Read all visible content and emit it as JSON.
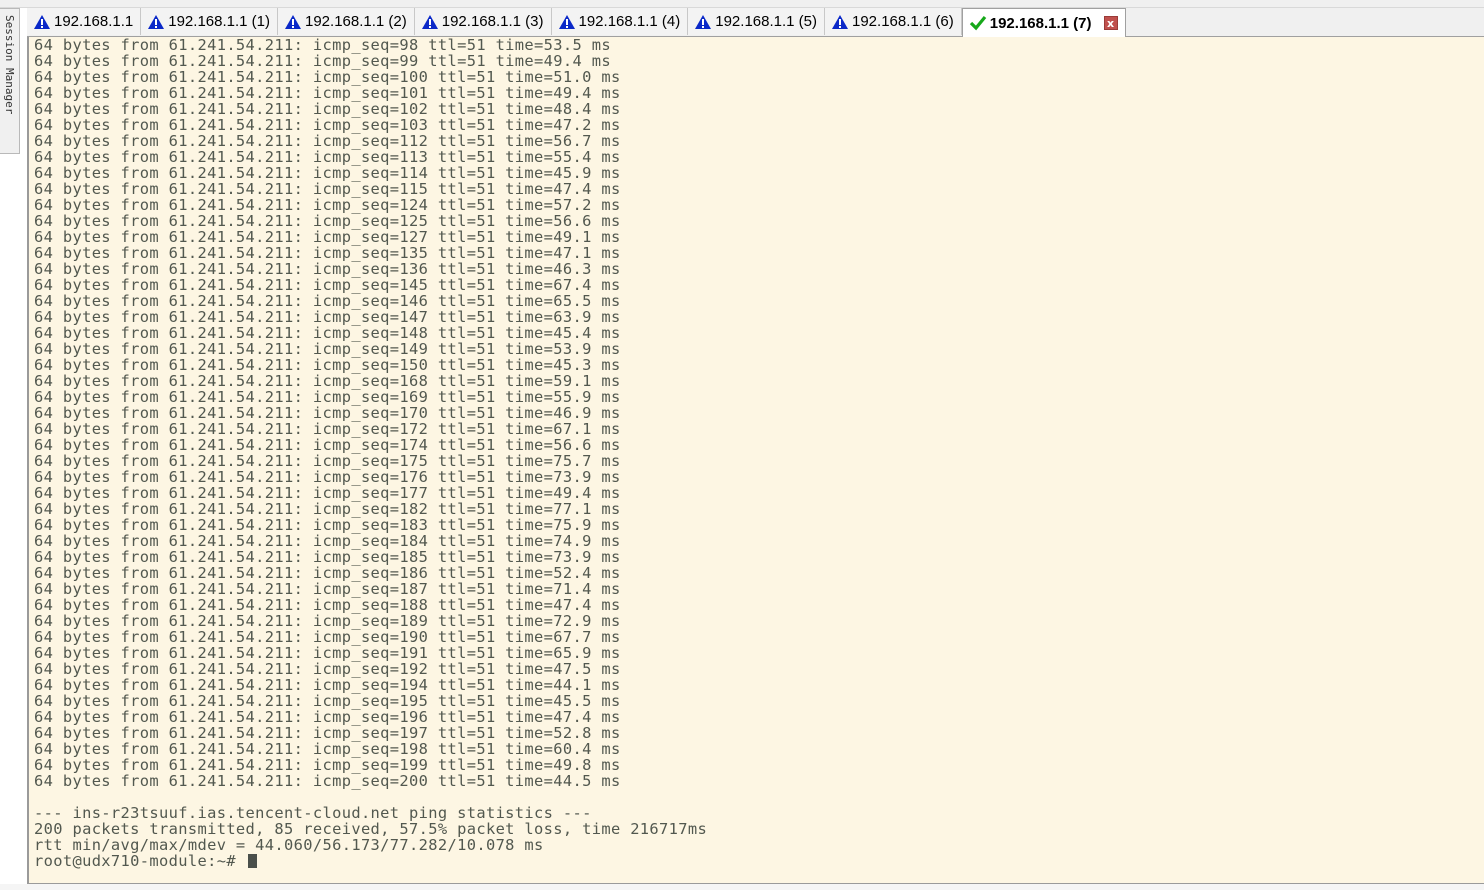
{
  "session_manager": {
    "label": "Session Manager"
  },
  "tabs": [
    {
      "label": "192.168.1.1",
      "status": "warning",
      "icon": "warning-triangle-icon"
    },
    {
      "label": "192.168.1.1 (1)",
      "status": "warning",
      "icon": "warning-triangle-icon"
    },
    {
      "label": "192.168.1.1 (2)",
      "status": "warning",
      "icon": "warning-triangle-icon"
    },
    {
      "label": "192.168.1.1 (3)",
      "status": "warning",
      "icon": "warning-triangle-icon"
    },
    {
      "label": "192.168.1.1 (4)",
      "status": "warning",
      "icon": "warning-triangle-icon"
    },
    {
      "label": "192.168.1.1 (5)",
      "status": "warning",
      "icon": "warning-triangle-icon"
    },
    {
      "label": "192.168.1.1 (6)",
      "status": "warning",
      "icon": "warning-triangle-icon"
    },
    {
      "label": "192.168.1.1 (7)",
      "status": "connected",
      "icon": "checkmark-icon",
      "active": true,
      "close": "x"
    }
  ],
  "colors": {
    "terminal_bg": "#fdf6e3",
    "terminal_fg": "#52584f",
    "warning_blue": "#0a28c8",
    "check_green": "#17a81a",
    "close_red": "#c0504d"
  },
  "terminal": {
    "ping_lines": [
      "64 bytes from 61.241.54.211: icmp_seq=98 ttl=51 time=53.5 ms",
      "64 bytes from 61.241.54.211: icmp_seq=99 ttl=51 time=49.4 ms",
      "64 bytes from 61.241.54.211: icmp_seq=100 ttl=51 time=51.0 ms",
      "64 bytes from 61.241.54.211: icmp_seq=101 ttl=51 time=49.4 ms",
      "64 bytes from 61.241.54.211: icmp_seq=102 ttl=51 time=48.4 ms",
      "64 bytes from 61.241.54.211: icmp_seq=103 ttl=51 time=47.2 ms",
      "64 bytes from 61.241.54.211: icmp_seq=112 ttl=51 time=56.7 ms",
      "64 bytes from 61.241.54.211: icmp_seq=113 ttl=51 time=55.4 ms",
      "64 bytes from 61.241.54.211: icmp_seq=114 ttl=51 time=45.9 ms",
      "64 bytes from 61.241.54.211: icmp_seq=115 ttl=51 time=47.4 ms",
      "64 bytes from 61.241.54.211: icmp_seq=124 ttl=51 time=57.2 ms",
      "64 bytes from 61.241.54.211: icmp_seq=125 ttl=51 time=56.6 ms",
      "64 bytes from 61.241.54.211: icmp_seq=127 ttl=51 time=49.1 ms",
      "64 bytes from 61.241.54.211: icmp_seq=135 ttl=51 time=47.1 ms",
      "64 bytes from 61.241.54.211: icmp_seq=136 ttl=51 time=46.3 ms",
      "64 bytes from 61.241.54.211: icmp_seq=145 ttl=51 time=67.4 ms",
      "64 bytes from 61.241.54.211: icmp_seq=146 ttl=51 time=65.5 ms",
      "64 bytes from 61.241.54.211: icmp_seq=147 ttl=51 time=63.9 ms",
      "64 bytes from 61.241.54.211: icmp_seq=148 ttl=51 time=45.4 ms",
      "64 bytes from 61.241.54.211: icmp_seq=149 ttl=51 time=53.9 ms",
      "64 bytes from 61.241.54.211: icmp_seq=150 ttl=51 time=45.3 ms",
      "64 bytes from 61.241.54.211: icmp_seq=168 ttl=51 time=59.1 ms",
      "64 bytes from 61.241.54.211: icmp_seq=169 ttl=51 time=55.9 ms",
      "64 bytes from 61.241.54.211: icmp_seq=170 ttl=51 time=46.9 ms",
      "64 bytes from 61.241.54.211: icmp_seq=172 ttl=51 time=67.1 ms",
      "64 bytes from 61.241.54.211: icmp_seq=174 ttl=51 time=56.6 ms",
      "64 bytes from 61.241.54.211: icmp_seq=175 ttl=51 time=75.7 ms",
      "64 bytes from 61.241.54.211: icmp_seq=176 ttl=51 time=73.9 ms",
      "64 bytes from 61.241.54.211: icmp_seq=177 ttl=51 time=49.4 ms",
      "64 bytes from 61.241.54.211: icmp_seq=182 ttl=51 time=77.1 ms",
      "64 bytes from 61.241.54.211: icmp_seq=183 ttl=51 time=75.9 ms",
      "64 bytes from 61.241.54.211: icmp_seq=184 ttl=51 time=74.9 ms",
      "64 bytes from 61.241.54.211: icmp_seq=185 ttl=51 time=73.9 ms",
      "64 bytes from 61.241.54.211: icmp_seq=186 ttl=51 time=52.4 ms",
      "64 bytes from 61.241.54.211: icmp_seq=187 ttl=51 time=71.4 ms",
      "64 bytes from 61.241.54.211: icmp_seq=188 ttl=51 time=47.4 ms",
      "64 bytes from 61.241.54.211: icmp_seq=189 ttl=51 time=72.9 ms",
      "64 bytes from 61.241.54.211: icmp_seq=190 ttl=51 time=67.7 ms",
      "64 bytes from 61.241.54.211: icmp_seq=191 ttl=51 time=65.9 ms",
      "64 bytes from 61.241.54.211: icmp_seq=192 ttl=51 time=47.5 ms",
      "64 bytes from 61.241.54.211: icmp_seq=194 ttl=51 time=44.1 ms",
      "64 bytes from 61.241.54.211: icmp_seq=195 ttl=51 time=45.5 ms",
      "64 bytes from 61.241.54.211: icmp_seq=196 ttl=51 time=47.4 ms",
      "64 bytes from 61.241.54.211: icmp_seq=197 ttl=51 time=52.8 ms",
      "64 bytes from 61.241.54.211: icmp_seq=198 ttl=51 time=60.4 ms",
      "64 bytes from 61.241.54.211: icmp_seq=199 ttl=51 time=49.8 ms",
      "64 bytes from 61.241.54.211: icmp_seq=200 ttl=51 time=44.5 ms"
    ],
    "blank_line": "",
    "stats_header": "--- ins-r23tsuuf.ias.tencent-cloud.net ping statistics ---",
    "stats_packets": "200 packets transmitted, 85 received, 57.5% packet loss, time 216717ms",
    "stats_rtt": "rtt min/avg/max/mdev = 44.060/56.173/77.282/10.078 ms",
    "prompt": "root@udx710-module:~# "
  }
}
